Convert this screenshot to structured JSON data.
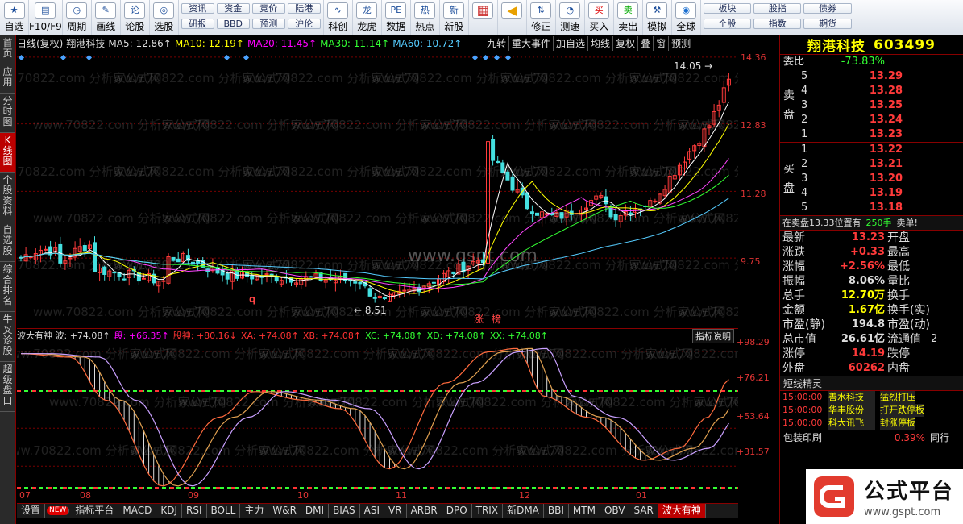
{
  "toolbar": {
    "big": [
      {
        "label": "自选",
        "icon": "star-icon"
      },
      {
        "label": "F10/F9",
        "icon": "f10-icon"
      },
      {
        "label": "周期",
        "icon": "clock-icon"
      },
      {
        "label": "画线",
        "icon": "pen-icon"
      },
      {
        "label": "论股",
        "icon": "discuss-icon"
      },
      {
        "label": "选股",
        "icon": "chart-select-icon"
      }
    ],
    "grid": [
      [
        "资讯",
        "资金",
        "竞价",
        "陆港"
      ],
      [
        "研报",
        "BBD",
        "预测",
        "沪伦"
      ]
    ],
    "big2": [
      {
        "label": "科创",
        "icon": "kechuang-icon"
      },
      {
        "label": "龙虎",
        "icon": "dragon-icon"
      },
      {
        "label": "数据",
        "icon": "pe-icon"
      },
      {
        "label": "热点",
        "icon": "hot-icon"
      },
      {
        "label": "新股",
        "icon": "newstock-icon"
      }
    ],
    "big3": [
      {
        "label": "",
        "icon": "color-grid-icon"
      },
      {
        "label": "",
        "icon": "back-arrow-icon"
      },
      {
        "label": "修正",
        "icon": "up-down-icon"
      },
      {
        "label": "测速",
        "icon": "speed-icon"
      },
      {
        "label": "买入",
        "icon": "buy-icon",
        "mark": "买"
      },
      {
        "label": "卖出",
        "icon": "sell-icon",
        "mark": "卖"
      },
      {
        "label": "模拟",
        "icon": "hammer-icon"
      },
      {
        "label": "全球",
        "icon": "globe-icon"
      }
    ],
    "grid2": [
      [
        "板块",
        "股指",
        "债券"
      ],
      [
        "个股",
        "指数",
        "期货"
      ]
    ]
  },
  "sidebar": [
    "首页",
    "应用",
    "分时图",
    "K线图",
    "个股资料",
    "自选股",
    "综合排名",
    "牛叉诊股",
    "超级盘口"
  ],
  "chart": {
    "header": [
      {
        "t": "日线(复权)",
        "c": "#ddd"
      },
      {
        "t": "翔港科技",
        "c": "#ddd"
      },
      {
        "t": "MA5: 12.86↑",
        "c": "#ddd"
      },
      {
        "t": "MA10: 12.19↑",
        "c": "#ff0"
      },
      {
        "t": "MA20: 11.45↑",
        "c": "#f0f"
      },
      {
        "t": "MA30: 11.14↑",
        "c": "#3f3"
      },
      {
        "t": "MA60: 10.72↑",
        "c": "#5cf"
      }
    ],
    "buttons": [
      "九转",
      "重大事件",
      "加自选",
      "均线",
      "复权",
      "叠",
      "窗",
      "预测"
    ],
    "y_labels": [
      "14.36",
      "12.83",
      "11.28",
      "9.75"
    ],
    "high_label": "14.05",
    "low_label": "8.51",
    "tags": [
      "涨",
      "榜"
    ],
    "q_mark": "q",
    "site_watermark": "www.gspt.com",
    "watermark": "www.70822.com 分析家公式网"
  },
  "indicator": {
    "header": [
      {
        "t": "波大有神 波: +74.08↑",
        "c": "#ddd"
      },
      {
        "t": "段: +66.35↑",
        "c": "#f0f"
      },
      {
        "t": "股神: +80.16↓",
        "c": "#f33"
      },
      {
        "t": "XA: +74.08↑",
        "c": "#f33"
      },
      {
        "t": "XB: +74.08↑",
        "c": "#f33"
      },
      {
        "t": "XC: +74.08↑",
        "c": "#3f3"
      },
      {
        "t": "XD: +74.08↑",
        "c": "#3f3"
      },
      {
        "t": "XX: +74.08↑",
        "c": "#3f3"
      }
    ],
    "button": "指标说明",
    "y_labels": [
      "+98.29",
      "+76.21",
      "+53.64",
      "+31.57"
    ]
  },
  "x_labels": [
    "07",
    "08",
    "09",
    "10",
    "11",
    "12",
    "01"
  ],
  "bottom_tabs": [
    "设置",
    "NEW",
    "指标平台",
    "MACD",
    "KDJ",
    "RSI",
    "BOLL",
    "主力",
    "W&R",
    "DMI",
    "BIAS",
    "ASI",
    "VR",
    "ARBR",
    "DPO",
    "TRIX",
    "新DMA",
    "BBI",
    "MTM",
    "OBV",
    "SAR",
    "波大有神"
  ],
  "quote": {
    "name": "翔港科技",
    "code": "603499",
    "weibi_label": "委比",
    "weibi": "-73.83%",
    "sell_label": "卖盘",
    "buy_label": "买盘",
    "asks": [
      [
        "5",
        "13.29"
      ],
      [
        "4",
        "13.28"
      ],
      [
        "3",
        "13.25"
      ],
      [
        "2",
        "13.24"
      ],
      [
        "1",
        "13.23"
      ]
    ],
    "bids": [
      [
        "1",
        "13.22"
      ],
      [
        "2",
        "13.21"
      ],
      [
        "3",
        "13.20"
      ],
      [
        "4",
        "13.19"
      ],
      [
        "5",
        "13.18"
      ]
    ],
    "trade_line": "在卖盘13.33位置有",
    "trade_vol": "250手",
    "trade_act": "卖单!",
    "stats": [
      [
        "最新",
        "13.23",
        "开盘",
        ""
      ],
      [
        "涨跌",
        "+0.33",
        "最高",
        ""
      ],
      [
        "涨幅",
        "+2.56%",
        "最低",
        ""
      ],
      [
        "振幅",
        "8.06%",
        "量比",
        ""
      ],
      [
        "总手",
        "12.70万",
        "换手",
        ""
      ],
      [
        "金额",
        "1.67亿",
        "换手(实)",
        ""
      ],
      [
        "市盈(静)",
        "194.8",
        "市盈(动)",
        ""
      ],
      [
        "总市值",
        "26.61亿",
        "流通值",
        "2"
      ],
      [
        "涨停",
        "14.19",
        "跌停",
        ""
      ],
      [
        "外盘",
        "60262",
        "内盘",
        ""
      ]
    ],
    "elf_title": "短线精灵",
    "elf": [
      [
        "15:00:00",
        "善水科技",
        "猛烈打压"
      ],
      [
        "15:00:00",
        "华丰股份",
        "打开跌停板"
      ],
      [
        "15:00:00",
        "科大讯飞",
        "封涨停板"
      ]
    ],
    "sector": "包装印刷",
    "sector_pct": "0.39%",
    "tongxing": "同行"
  },
  "logo": {
    "text": "公式平台",
    "url": "www.gspt.com"
  }
}
